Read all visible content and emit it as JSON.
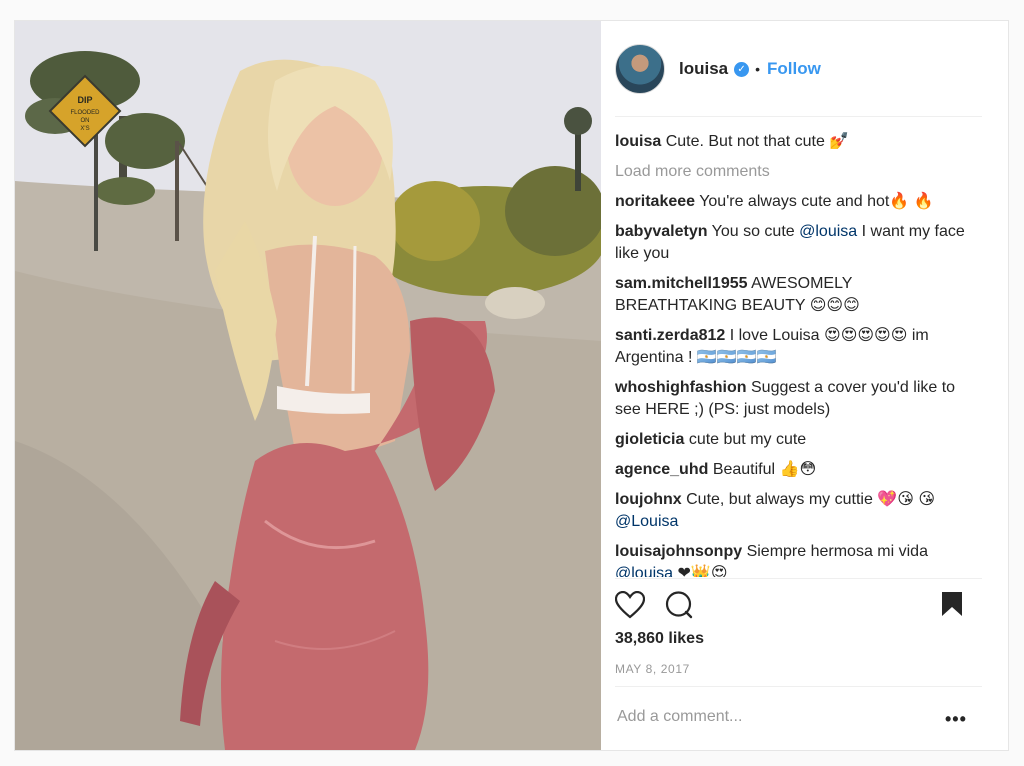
{
  "post": {
    "username": "louisa",
    "verified_mark": "✓",
    "separator": "•",
    "follow_label": "Follow",
    "caption": {
      "user": "louisa",
      "text": "Cute. But not that cute 💅"
    },
    "load_more_label": "Load more comments",
    "comments": [
      {
        "user": "noritakeee",
        "text": "You're always cute and hot🔥 🔥"
      },
      {
        "user": "babyvaletyn",
        "text": "You so cute",
        "mention": "@louisa",
        "text_after": "I want my face like you"
      },
      {
        "user": "sam.mitchell1955",
        "text": "AWESOMELY BREATHTAKING BEAUTY 😊😊😊"
      },
      {
        "user": "santi.zerda812",
        "text": "I love Louisa 😍😍😍😍😍 im Argentina ! 🇦🇷🇦🇷🇦🇷🇦🇷"
      },
      {
        "user": "whoshighfashion",
        "text": "Suggest a cover you'd like to see HERE ;) (PS: just models)"
      },
      {
        "user": "gioleticia",
        "text": "cute but my cute"
      },
      {
        "user": "agence_uhd",
        "text": "Beautiful 👍😳"
      },
      {
        "user": "loujohnx",
        "text": "Cute, but always my cuttie 💖😘 😘",
        "mention": "@Louisa",
        "text_after": ""
      },
      {
        "user": "louisajohnsonpy",
        "text": "Siempre hermosa mi vida",
        "mention": "@louisa",
        "text_after": "❤👑😍"
      }
    ],
    "likes": "38,860 likes",
    "date": "MAY 8, 2017",
    "add_comment_placeholder": "Add a comment...",
    "more_label": "•••"
  },
  "sign": {
    "line1": "DIP",
    "line2": "FLOODED",
    "line3": "ON",
    "line4": "X'S"
  },
  "colors": {
    "link_blue": "#3897f0",
    "mention_blue": "#003569",
    "muted": "#999999",
    "robe": "#c46a6e"
  }
}
